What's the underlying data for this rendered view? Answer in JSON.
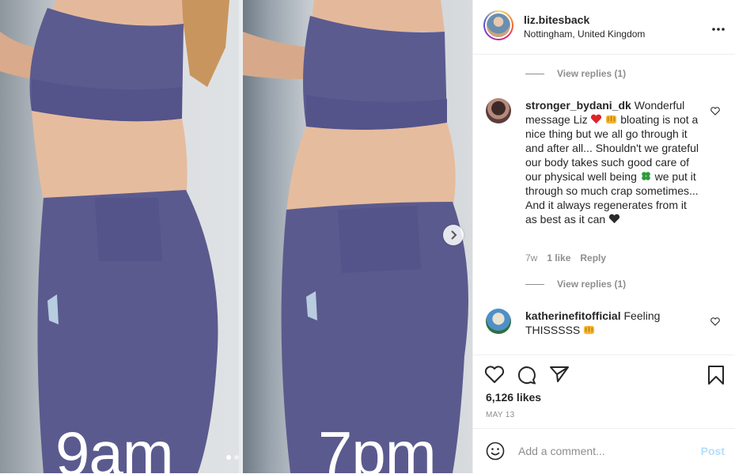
{
  "post": {
    "username": "liz.bitesback",
    "location": "Nottingham, United Kingdom"
  },
  "media": {
    "left_label": "9am",
    "right_label": "7pm",
    "slide_count": 2,
    "active_slide": 1
  },
  "comments": {
    "view_replies_top": "View replies (1)",
    "items": [
      {
        "username": "stronger_bydani_dk",
        "text_part1": "Wonderful message Liz",
        "text_part2": "bloating is not a nice thing but we all go through it and after all... Shouldn't we grateful our body takes such good care of our physical well being",
        "text_part3": "we put it through so much crap sometimes... And it always regenerates from it as best as it can",
        "time": "7w",
        "likes": "1 like",
        "reply": "Reply",
        "view_replies": "View replies (1)"
      },
      {
        "username": "katherinefitofficial",
        "text": "Feeling THISSSSS"
      }
    ]
  },
  "actions": {
    "likes": "6,126 likes",
    "date": "MAY 13"
  },
  "add_comment": {
    "placeholder": "Add a comment...",
    "post_label": "Post"
  },
  "colors": {
    "leggings": "#5b5a8e",
    "skin": "#e2b698",
    "link_post": "#b2dffc",
    "secondary_text": "#8e8e8e"
  }
}
